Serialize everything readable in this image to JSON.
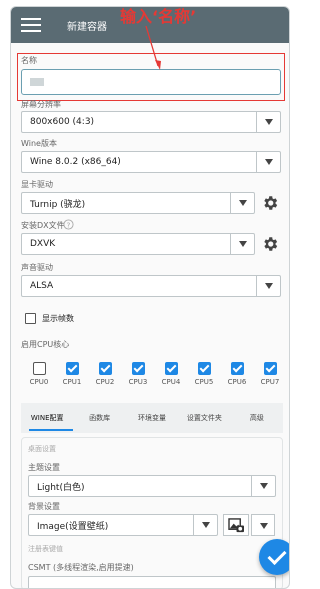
{
  "appbar": {
    "title": "新建容器"
  },
  "annotation": {
    "text": "输入‘名称’"
  },
  "form": {
    "name_label": "名称",
    "name_value": "",
    "resolution_label": "屏幕分辨率",
    "resolution_value": "800x600 (4:3)",
    "wine_label": "Wine版本",
    "wine_value": "Wine 8.0.2 (x86_64)",
    "gpu_label": "显卡驱动",
    "gpu_value": "Turnip (骁龙)",
    "dx_label": "安装DX文件",
    "dx_value": "DXVK",
    "audio_label": "声音驱动",
    "audio_value": "ALSA",
    "show_fps_label": "显示帧数",
    "show_fps_checked": false,
    "cpu_label": "启用CPU核心",
    "cpu_cores": [
      {
        "label": "CPU0",
        "checked": false
      },
      {
        "label": "CPU1",
        "checked": true
      },
      {
        "label": "CPU2",
        "checked": true
      },
      {
        "label": "CPU3",
        "checked": true
      },
      {
        "label": "CPU4",
        "checked": true
      },
      {
        "label": "CPU5",
        "checked": true
      },
      {
        "label": "CPU6",
        "checked": true
      },
      {
        "label": "CPU7",
        "checked": true
      }
    ]
  },
  "tabs": [
    "WINE配置",
    "函数库",
    "环境变量",
    "设置文件夹",
    "高级"
  ],
  "wine_section": {
    "desktop_title": "桌面设置",
    "theme_label": "主题设置",
    "theme_value": "Light(白色)",
    "background_label": "背景设置",
    "background_value": "Image(设置壁纸)",
    "registry_title": "注册表键值",
    "csmt_label": "CSMT (多线程渲染,启用提速)"
  },
  "colors": {
    "appbar": "#5a6b73",
    "accent": "#1e88e5",
    "annotation": "#e53935"
  }
}
